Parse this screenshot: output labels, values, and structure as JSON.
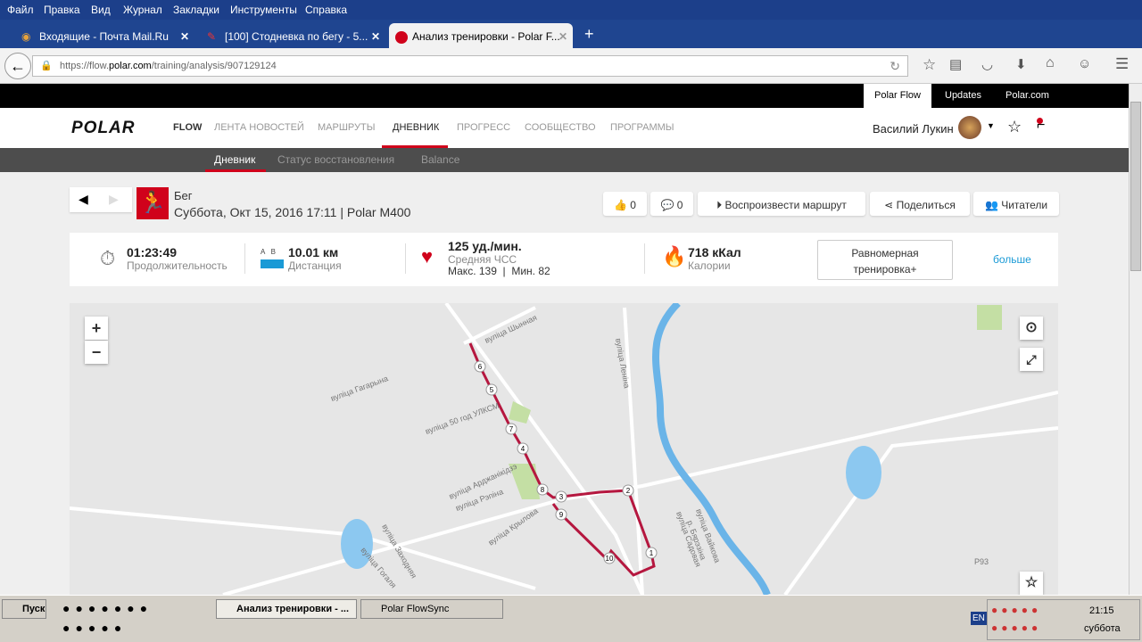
{
  "menu": [
    "Файл",
    "Правка",
    "Вид",
    "Журнал",
    "Закладки",
    "Инструменты",
    "Справка"
  ],
  "tabs": [
    {
      "label": "Входящие - Почта Mail.Ru"
    },
    {
      "label": "[100] Стодневка по бегу - 5..."
    },
    {
      "label": "Анализ тренировки - Polar F..."
    }
  ],
  "url": {
    "prefix": "https://flow.",
    "domain": "polar.com",
    "path": "/training/analysis/907129124"
  },
  "topstrip": [
    "Polar Flow",
    "Updates",
    "Polar.com"
  ],
  "brand": {
    "logo": "POLAR",
    "product": "FLOW"
  },
  "nav": [
    "ЛЕНТА НОВОСТЕЙ",
    "МАРШРУТЫ",
    "ДНЕВНИК",
    "ПРОГРЕСС",
    "СООБЩЕСТВО",
    "ПРОГРАММЫ"
  ],
  "user": {
    "name": "Василий Лукин"
  },
  "subnav": [
    "Дневник",
    "Статус восстановления",
    "Balance"
  ],
  "activity": {
    "sport": "Бег",
    "subtitle": "Суббота, Окт 15, 2016 17:11 | Polar M400"
  },
  "actions": {
    "likes": "0",
    "comments": "0",
    "replay": "Воспроизвести маршрут",
    "share": "Поделиться",
    "readers": "Читатели"
  },
  "summary": {
    "duration": "01:23:49",
    "duration_label": "Продолжительность",
    "ab": "A   B",
    "distance": "10.01 км",
    "distance_label": "Дистанция",
    "hr": "125 уд./мин.",
    "hr_label": "Средняя ЧСС",
    "hr_minmax": "Макс. 139  |  Мин. 82",
    "calories": "718 кКал",
    "calories_label": "Калории",
    "benefit": "Равномерная тренировка+",
    "more": "больше"
  },
  "map": {
    "zoom_in": "+",
    "zoom_out": "−",
    "markers": [
      "1",
      "2",
      "3",
      "4",
      "5",
      "6",
      "7",
      "8",
      "9",
      "10"
    ],
    "streets": [
      "вуліца Шынная",
      "вуліца Леніна",
      "вуліца Гагарына",
      "вуліца 50 год УЛКСМ",
      "вуліца Арджанікідзэ",
      "вуліца Рэпіна",
      "вуліца Крылова",
      "вуліца Заходняя",
      "вуліца Гогаля",
      "р. Бярэзіна",
      "вуліца Садовая",
      "вуліца Вайкова",
      "Р93"
    ]
  },
  "taskbar": {
    "start": "Пуск",
    "items": [
      "Анализ тренировки - ...",
      "Polar FlowSync"
    ],
    "lang": "EN",
    "time": "21:15",
    "day": "суббота"
  },
  "colors": {
    "accent": "#d0021b",
    "route": "#b5173f",
    "link": "#1a9ad6"
  }
}
